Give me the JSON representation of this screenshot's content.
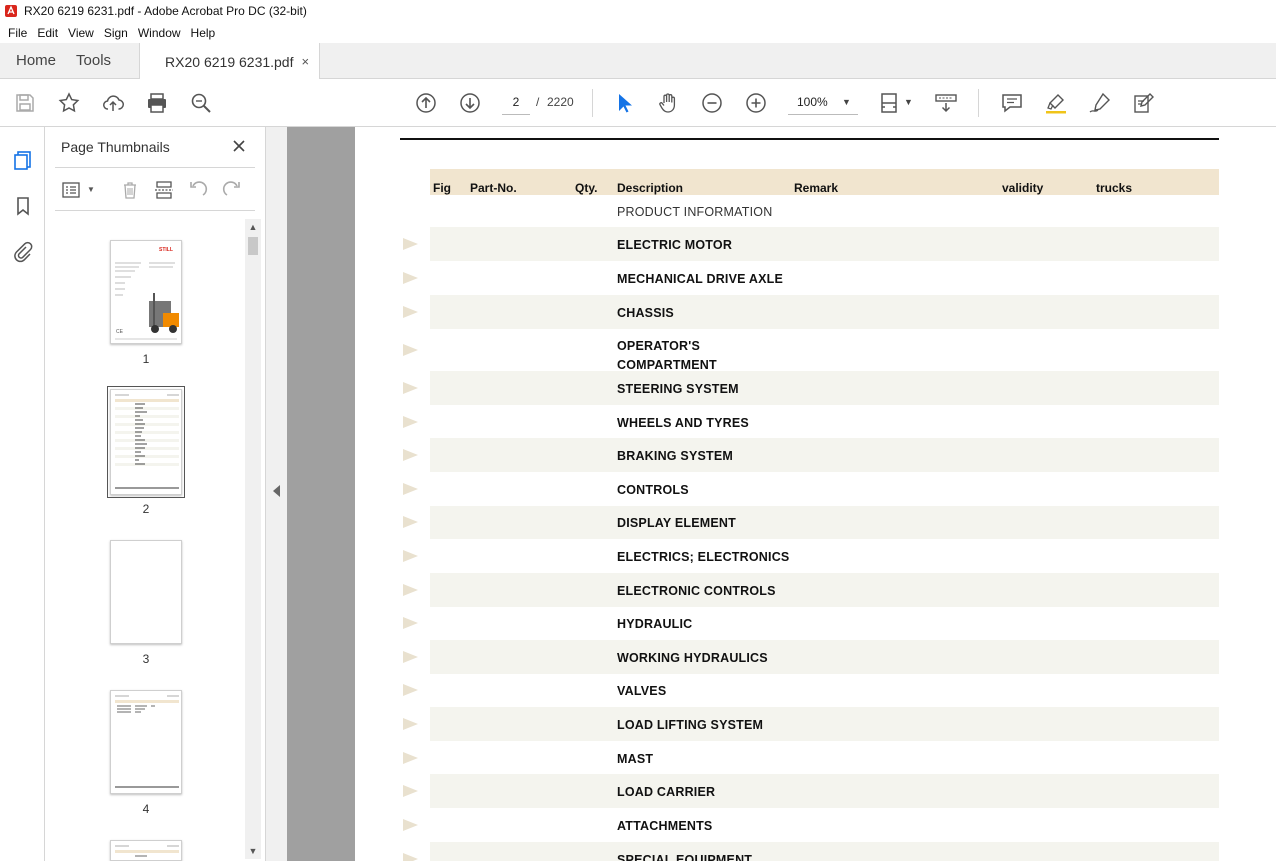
{
  "window": {
    "title": "RX20 6219 6231.pdf - Adobe Acrobat Pro DC (32-bit)"
  },
  "menu": [
    "File",
    "Edit",
    "View",
    "Sign",
    "Window",
    "Help"
  ],
  "tabs": {
    "home": "Home",
    "tools": "Tools",
    "document": "RX20 6219 6231.pdf",
    "close_glyph": "×"
  },
  "toolbar": {
    "current_page": "2",
    "page_separator": "/",
    "total_pages": "2220",
    "zoom": "100%"
  },
  "thumbnails_panel": {
    "title": "Page Thumbnails",
    "close_glyph": "✕",
    "pages": [
      "1",
      "2",
      "3",
      "4"
    ],
    "selected_page": "2"
  },
  "document_page": {
    "columns": [
      "Fig",
      "Part-No.",
      "Qty.",
      "Description",
      "Remark",
      "validity",
      "trucks"
    ],
    "rows": [
      {
        "description": "PRODUCT INFORMATION"
      },
      {
        "description": "ELECTRIC MOTOR"
      },
      {
        "description": "MECHANICAL DRIVE AXLE"
      },
      {
        "description": "CHASSIS"
      },
      {
        "description": "OPERATOR'S",
        "description_line2": "COMPARTMENT"
      },
      {
        "description": "STEERING SYSTEM"
      },
      {
        "description": "WHEELS AND TYRES"
      },
      {
        "description": "BRAKING SYSTEM"
      },
      {
        "description": "CONTROLS"
      },
      {
        "description": "DISPLAY ELEMENT"
      },
      {
        "description": "ELECTRICS; ELECTRONICS"
      },
      {
        "description": "ELECTRONIC CONTROLS"
      },
      {
        "description": "HYDRAULIC"
      },
      {
        "description": "WORKING HYDRAULICS"
      },
      {
        "description": "VALVES"
      },
      {
        "description": "LOAD LIFTING SYSTEM"
      },
      {
        "description": "MAST"
      },
      {
        "description": "LOAD CARRIER"
      },
      {
        "description": "ATTACHMENTS"
      },
      {
        "description": "SPECIAL EQUIPMENT"
      }
    ]
  },
  "colors": {
    "header_band": "#f1e5cf",
    "row_shade": "#f4f4ee",
    "accent_blue": "#1473e6",
    "viewer_bg": "#a0a0a0"
  },
  "icons": {
    "toolbar": [
      "save-icon",
      "bookmark-star-icon",
      "upload-icon",
      "print-icon",
      "search-zoom-icon",
      "previous-page-icon",
      "next-page-icon",
      "select-arrow-icon",
      "hand-pan-icon",
      "zoom-out-icon",
      "zoom-in-icon",
      "page-fit-icon",
      "scroll-mode-icon",
      "comment-icon",
      "highlight-icon",
      "sign-pen-icon",
      "edit-pdf-icon"
    ],
    "rail": [
      "page-thumbnails-icon",
      "bookmarks-icon",
      "attachments-icon"
    ]
  }
}
